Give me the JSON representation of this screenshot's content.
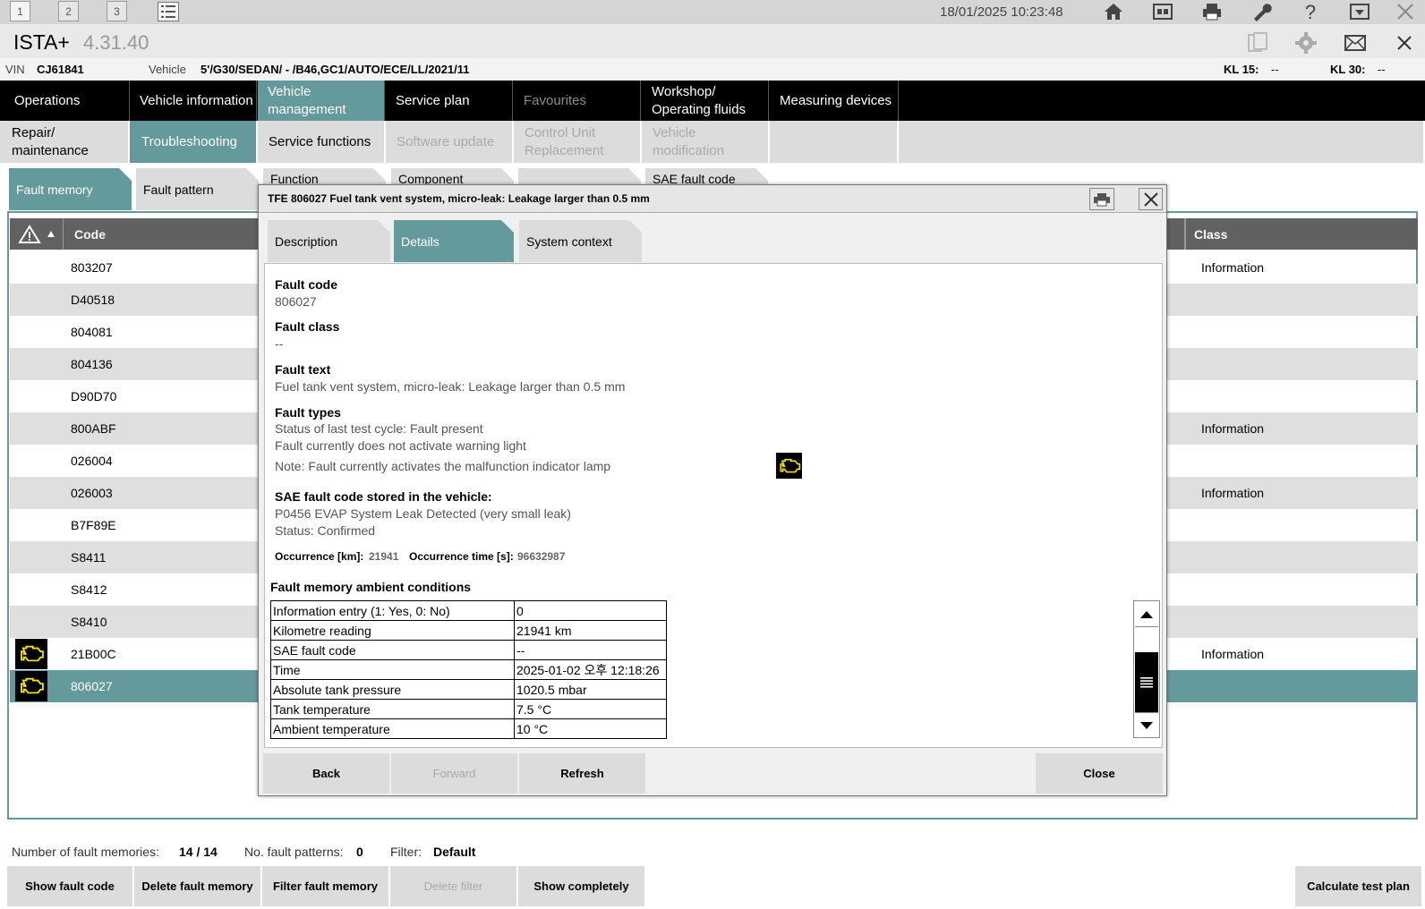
{
  "topbar": {
    "tabs": [
      "1",
      "2",
      "3"
    ],
    "datetime": "18/01/2025 10:23:48"
  },
  "app": {
    "name": "ISTA+",
    "version": "4.31.40"
  },
  "vehicle_row": {
    "vin_label": "VIN",
    "vin": "CJ61841",
    "vehicle_label": "Vehicle",
    "vehicle": "5'/G30/SEDAN/ - /B46,GC1/AUTO/ECE/LL/2021/11",
    "kl15_label": "KL 15:",
    "kl15": "--",
    "kl30_label": "KL 30:",
    "kl30": "--"
  },
  "main_nav": [
    {
      "label": "Operations"
    },
    {
      "label": "Vehicle information"
    },
    {
      "label": "Vehicle management"
    },
    {
      "label": "Service plan"
    },
    {
      "label": "Favourites"
    },
    {
      "label": "Workshop/ Operating fluids"
    },
    {
      "label": "Measuring devices"
    }
  ],
  "sub_nav": [
    {
      "label": "Repair/ maintenance"
    },
    {
      "label": "Troubleshooting"
    },
    {
      "label": "Service functions"
    },
    {
      "label": "Software update"
    },
    {
      "label": "Control Unit Replacement"
    },
    {
      "label": "Vehicle modification"
    }
  ],
  "fault_tabs": [
    {
      "label": "Fault memory"
    },
    {
      "label": "Fault pattern"
    },
    {
      "label": "Function"
    },
    {
      "label": "Component"
    },
    {
      "label": ""
    },
    {
      "label": "SAE fault code"
    }
  ],
  "list": {
    "headers": {
      "code": "Code",
      "class": "Class"
    },
    "rows": [
      {
        "code": "803207",
        "class": "Information",
        "icon": ""
      },
      {
        "code": "D40518",
        "class": "",
        "icon": ""
      },
      {
        "code": "804081",
        "class": "",
        "icon": ""
      },
      {
        "code": "804136",
        "class": "",
        "icon": ""
      },
      {
        "code": "D90D70",
        "class": "",
        "icon": ""
      },
      {
        "code": "800ABF",
        "class": "Information",
        "icon": ""
      },
      {
        "code": "026004",
        "class": "",
        "icon": ""
      },
      {
        "code": "026003",
        "class": "Information",
        "icon": ""
      },
      {
        "code": "B7F89E",
        "class": "",
        "icon": ""
      },
      {
        "code": "S8411",
        "class": "",
        "icon": ""
      },
      {
        "code": "S8412",
        "class": "",
        "icon": ""
      },
      {
        "code": "S8410",
        "class": "",
        "icon": ""
      },
      {
        "code": "21B00C",
        "class": "Information",
        "icon": "engine-check-icon"
      },
      {
        "code": "806027",
        "class": "",
        "icon": "engine-check-icon",
        "selected": true
      }
    ]
  },
  "footer": {
    "count_label": "Number of fault memories:",
    "count": "14 / 14",
    "patterns_label": "No. fault patterns:",
    "patterns": "0",
    "filter_label": "Filter:",
    "filter": "Default",
    "buttons": {
      "show_fault_code": "Show fault code",
      "delete_fault_memory": "Delete fault memory",
      "filter_fault_memory": "Filter fault memory",
      "delete_filter": "Delete filter",
      "show_completely": "Show completely",
      "calculate_test_plan": "Calculate test plan"
    }
  },
  "dialog": {
    "title": "TFE 806027 Fuel tank vent system, micro-leak: Leakage larger than 0.5 mm",
    "tabs": [
      {
        "label": "Description"
      },
      {
        "label": "Details"
      },
      {
        "label": "System context"
      }
    ],
    "fault_code_label": "Fault code",
    "fault_code": "806027",
    "fault_class_label": "Fault class",
    "fault_class": "--",
    "fault_text_label": "Fault text",
    "fault_text": "Fuel tank vent system, micro-leak: Leakage larger than 0.5 mm",
    "fault_types_label": "Fault types",
    "fault_types": [
      "Status of last test cycle: Fault present",
      "Fault currently does not activate warning light",
      "Note: Fault currently activates the malfunction indicator lamp"
    ],
    "sae_label": "SAE fault code stored in the vehicle:",
    "sae_code": "P0456 EVAP System Leak Detected (very small leak)",
    "sae_status": "Status: Confirmed",
    "occurrence_km_label": "Occurrence [km]:",
    "occurrence_km": "21941",
    "occurrence_time_label": "Occurrence time [s]:",
    "occurrence_time": "96632987",
    "ambient_label": "Fault memory ambient conditions",
    "ambient": [
      {
        "name": "Information entry (1: Yes, 0: No)",
        "value": "0"
      },
      {
        "name": "Kilometre reading",
        "value": "21941 km"
      },
      {
        "name": "SAE fault code",
        "value": "--"
      },
      {
        "name": "Time",
        "value": "2025-01-02 오후 12:18:26"
      },
      {
        "name": "Absolute tank pressure",
        "value": "1020.5 mbar"
      },
      {
        "name": "Tank temperature",
        "value": "7.5 °C"
      },
      {
        "name": "Ambient temperature",
        "value": "10 °C"
      }
    ],
    "buttons": {
      "back": "Back",
      "forward": "Forward",
      "refresh": "Refresh",
      "close": "Close"
    }
  },
  "colors": {
    "accent": "#659a9d",
    "nav_bg": "#000000",
    "header_bg": "#616161",
    "engine_icon": "#f2e200"
  }
}
